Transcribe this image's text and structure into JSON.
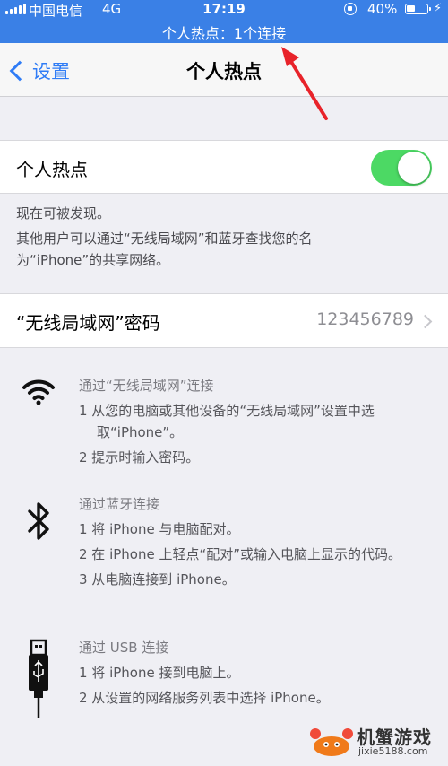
{
  "status_bar": {
    "carrier": "中国电信",
    "network": "4G",
    "time": "17:19",
    "battery_percent": "40%",
    "hotspot_banner": "个人热点：1个连接"
  },
  "nav": {
    "back_label": "设置",
    "title": "个人热点"
  },
  "hotspot": {
    "label": "个人热点",
    "enabled": true,
    "footnote_line1": "现在可被发现。",
    "footnote_line2": "其他用户可以通过“无线局域网”和蓝牙查找您的名",
    "footnote_line3": "为“iPhone”的共享网络。"
  },
  "wifi_password": {
    "label": "“无线局域网”密码",
    "value": "123456789"
  },
  "instructions": {
    "wifi": {
      "heading": "通过“无线局域网”连接",
      "step1": "1 从您的电脑或其他设备的“无线局域网”设置中选取“iPhone”。",
      "step2": "2 提示时输入密码。"
    },
    "bluetooth": {
      "heading": "通过蓝牙连接",
      "step1": "1 将 iPhone 与电脑配对。",
      "step2": "2 在 iPhone 上轻点“配对”或输入电脑上显示的代码。",
      "step3": "3 从电脑连接到 iPhone。"
    },
    "usb": {
      "heading": "通过 USB 连接",
      "step1": "1 将 iPhone 接到电脑上。",
      "step2": "2 从设置的网络服务列表中选择 iPhone。"
    }
  },
  "watermark": {
    "brand": "机蟹游戏",
    "url": "jixie5188.com"
  },
  "colors": {
    "status_bar": "#3a80e6",
    "accent": "#2f7cf6",
    "switch_on": "#4cd964",
    "annotation_arrow": "#e8232a"
  },
  "icons": [
    "wifi-icon",
    "bluetooth-icon",
    "usb-icon",
    "chevron-left-icon",
    "chevron-right-icon",
    "battery-icon",
    "rotation-lock-icon",
    "charging-bolt-icon"
  ]
}
